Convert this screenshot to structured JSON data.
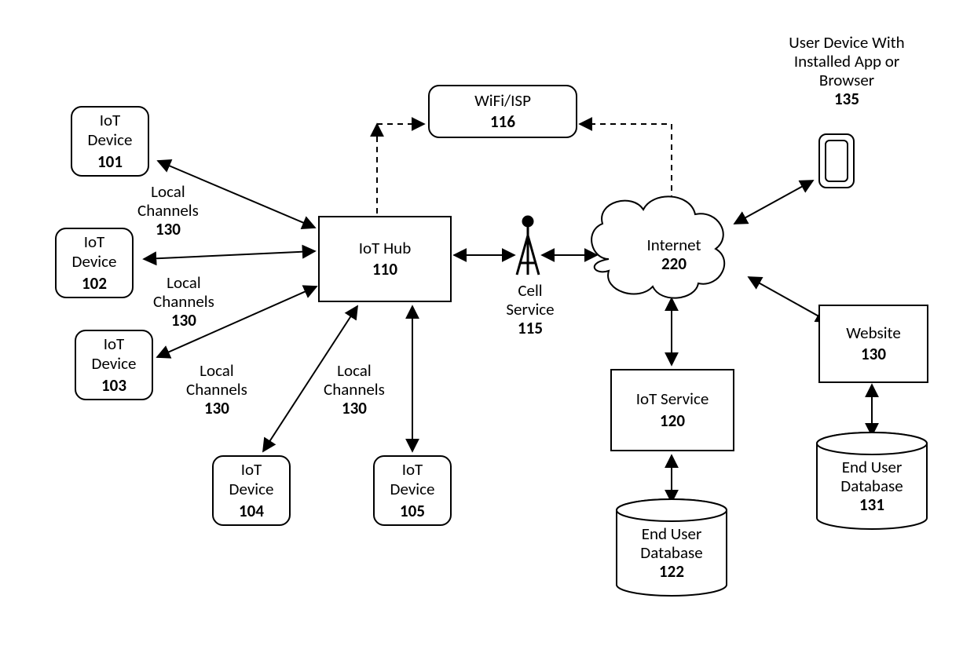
{
  "nodes": {
    "iot101": {
      "title": "IoT\nDevice",
      "num": "101"
    },
    "iot102": {
      "title": "IoT\nDevice",
      "num": "102"
    },
    "iot103": {
      "title": "IoT\nDevice",
      "num": "103"
    },
    "iot104": {
      "title": "IoT\nDevice",
      "num": "104"
    },
    "iot105": {
      "title": "IoT\nDevice",
      "num": "105"
    },
    "hub": {
      "title": "IoT Hub",
      "num": "110"
    },
    "wifi": {
      "title": "WiFi/ISP",
      "num": "116"
    },
    "internet": {
      "title": "Internet",
      "num": "220"
    },
    "cell": {
      "title": "Cell\nService",
      "num": "115"
    },
    "iotsvc": {
      "title": "IoT Service",
      "num": "120"
    },
    "website": {
      "title": "Website",
      "num": "130"
    },
    "db122": {
      "title": "End User\nDatabase",
      "num": "122"
    },
    "db131": {
      "title": "End User\nDatabase",
      "num": "131"
    },
    "userdev": {
      "caption": "User Device With\nInstalled App or\nBrowser",
      "num": "135"
    }
  },
  "labels": {
    "lc1": {
      "t": "Local\nChannels",
      "n": "130"
    },
    "lc2": {
      "t": "Local\nChannels",
      "n": "130"
    },
    "lc3": {
      "t": "Local\nChannels",
      "n": "130"
    },
    "lc4": {
      "t": "Local\nChannels",
      "n": "130"
    }
  }
}
